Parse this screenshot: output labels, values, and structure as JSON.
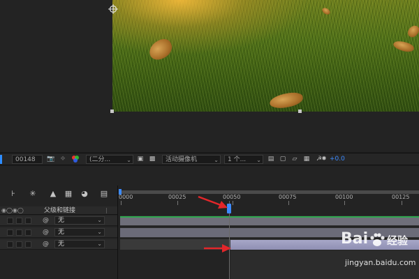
{
  "toolbar": {
    "timecode": "00148",
    "resolution": "(二分...",
    "camera": "活动摄像机",
    "views": "1 个...",
    "exposure": "+0.0"
  },
  "timeline": {
    "column_header": "父级和链接",
    "ruler_labels": [
      "0000",
      "00025",
      "00050",
      "00075",
      "00100",
      "00125"
    ],
    "layers": [
      {
        "parent": "无"
      },
      {
        "parent": "无"
      },
      {
        "parent": "无"
      }
    ]
  },
  "watermark": {
    "brand": "Bai",
    "brand_cn": "经验",
    "url": "jingyan.baidu.com"
  },
  "colors": {
    "accent_blue": "#3d8bff",
    "layer_green": "#2fa84f",
    "bar_lavender": "#8f8fb3",
    "arrow_red": "#e3262a"
  },
  "icons": [
    "anchor-point-icon",
    "camera-icon",
    "color-channel-icon",
    "fit-icon",
    "toggle-transparency-icon",
    "3d-view-icon",
    "flowchart-icon",
    "fast-preview-icon",
    "spiral-pickwhip-icon"
  ]
}
